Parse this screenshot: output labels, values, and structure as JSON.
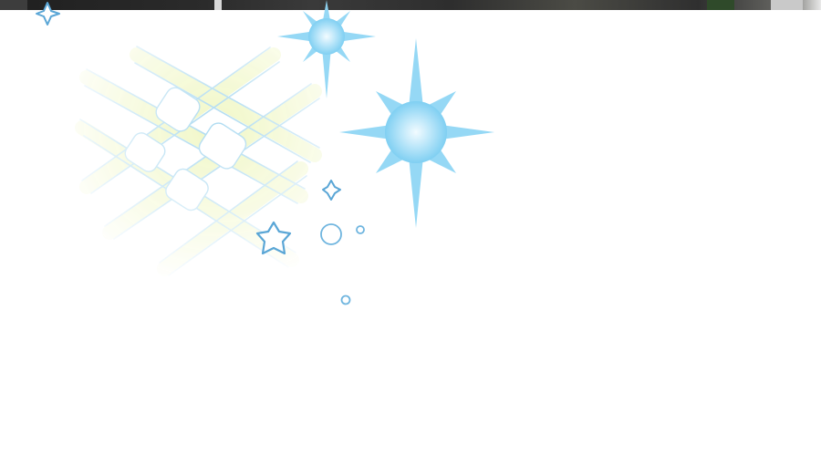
{
  "scene": {
    "description_free": true,
    "background_color": "#ffffff",
    "strip_color": "#2b2b2b",
    "sparkle_color": "#7fcff2",
    "sparkle_core_color": "#d9f2fc",
    "outline_color": "#5aa6d6",
    "lattice_color": "#f1f7c6",
    "lattice_outline_color": "#a8d8f0"
  }
}
